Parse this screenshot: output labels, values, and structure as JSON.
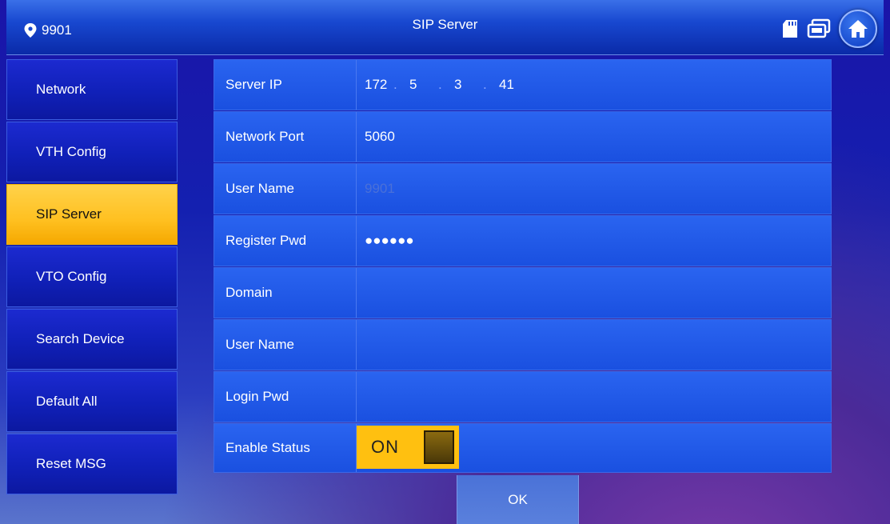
{
  "header": {
    "device_id": "9901",
    "title": "SIP Server",
    "icons": [
      "location-pin-icon",
      "sd-card-icon",
      "screens-icon",
      "home-icon"
    ]
  },
  "sidebar": {
    "items": [
      {
        "label": "Network",
        "active": false
      },
      {
        "label": "VTH Config",
        "active": false
      },
      {
        "label": "SIP Server",
        "active": true
      },
      {
        "label": "VTO Config",
        "active": false
      },
      {
        "label": "Search Device",
        "active": false
      },
      {
        "label": "Default All",
        "active": false
      },
      {
        "label": "Reset MSG",
        "active": false
      }
    ]
  },
  "form": {
    "server_ip": {
      "label": "Server IP",
      "octets": [
        "172",
        "5",
        "3",
        "41"
      ]
    },
    "network_port": {
      "label": "Network Port",
      "value": "5060"
    },
    "user_name": {
      "label": "User Name",
      "value": "9901"
    },
    "register_pwd": {
      "label": "Register Pwd",
      "value": "●●●●●●"
    },
    "domain": {
      "label": "Domain",
      "value": ""
    },
    "user_name_2": {
      "label": "User Name",
      "value": ""
    },
    "login_pwd": {
      "label": "Login Pwd",
      "value": ""
    },
    "enable_status": {
      "label": "Enable Status",
      "value": "ON"
    }
  },
  "ok_label": "OK",
  "colors": {
    "accent": "#ffc020",
    "row_bg": "#1a50e0",
    "sidebar_bg": "#1020b8"
  }
}
